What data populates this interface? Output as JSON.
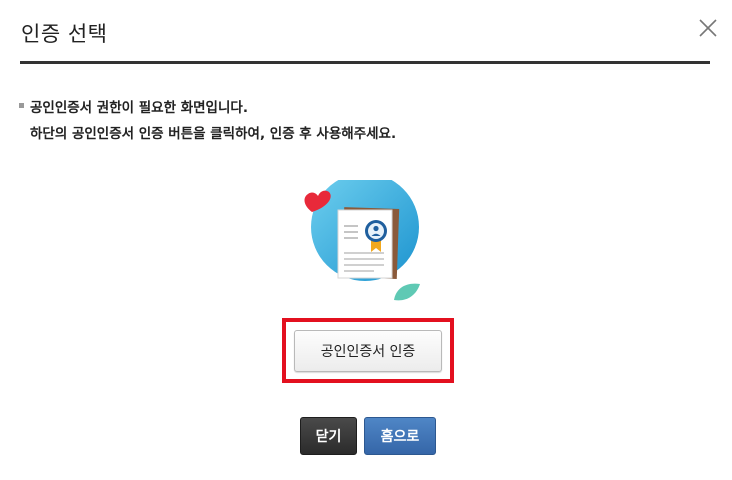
{
  "dialog": {
    "title": "인증 선택",
    "close_icon": "close-x-icon"
  },
  "notice": {
    "line1": "공인인증서 권한이 필요한 화면입니다.",
    "line2": "하단의 공인인증서 인증 버튼을 클릭하여, 인증 후 사용해주세요."
  },
  "illustration": {
    "icon": "certificate-document-icon",
    "colors": {
      "circle": "#2ea8d8",
      "heart": "#e8293a",
      "leaf": "#5fc9b4",
      "badge": "#1f5f9e"
    }
  },
  "actions": {
    "certificate_button": "공인인증서 인증",
    "close_button": "닫기",
    "home_button": "홈으로"
  },
  "colors": {
    "highlight_border": "#e3101f",
    "close_button_bg": "#333333",
    "home_button_bg": "#3f74b6"
  }
}
